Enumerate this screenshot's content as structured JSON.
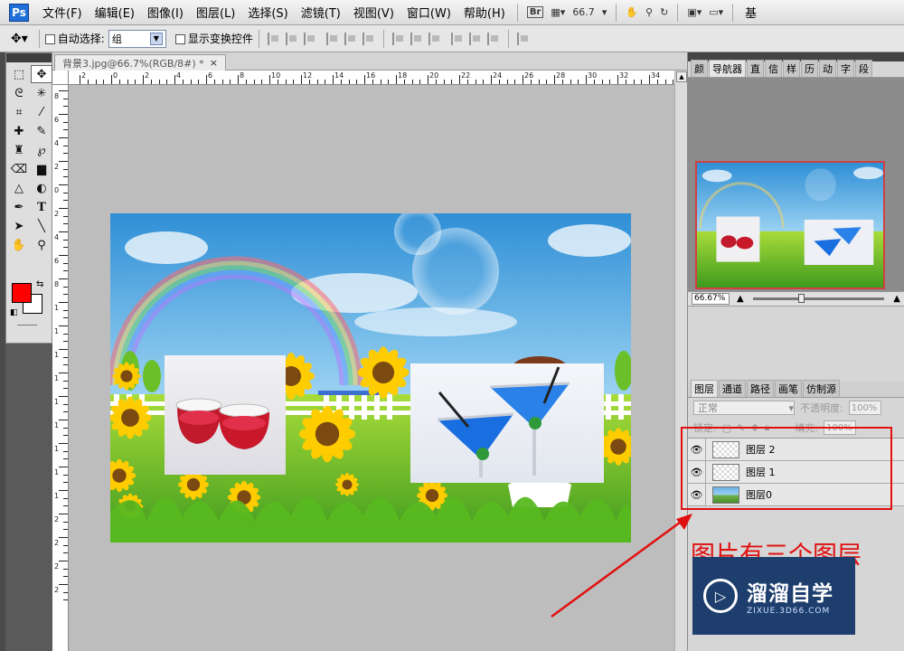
{
  "menubar": {
    "app_logo": "Ps",
    "items": [
      "文件(F)",
      "编辑(E)",
      "图像(I)",
      "图层(L)",
      "选择(S)",
      "滤镜(T)",
      "视图(V)",
      "窗口(W)",
      "帮助(H)"
    ],
    "bridge": "Br",
    "zoom_value": "66.7",
    "workspace": "基"
  },
  "options": {
    "auto_select_label": "自动选择:",
    "auto_select_value": "组",
    "show_transform_label": "显示变换控件"
  },
  "document": {
    "tab_title": "背景3.jpg@66.7%(RGB/8#) *",
    "close_glyph": "×",
    "ruler_h_labels": [
      "2",
      "0",
      "2",
      "4",
      "6",
      "8",
      "10",
      "12",
      "14",
      "16",
      "18",
      "20",
      "22",
      "24",
      "26",
      "28",
      "30",
      "32",
      "34"
    ],
    "ruler_v_labels": [
      "8",
      "6",
      "4",
      "2",
      "0",
      "2",
      "4",
      "6",
      "8",
      "1",
      "1",
      "1",
      "1",
      "1",
      "1",
      "1",
      "1",
      "1",
      "2",
      "2",
      "2",
      "2"
    ]
  },
  "navigator": {
    "tabs": [
      "颜",
      "导航器",
      "直",
      "信",
      "样",
      "历",
      "动",
      "字",
      "段"
    ],
    "zoom": "66.67%"
  },
  "layers": {
    "tabs": [
      "图层",
      "通道",
      "路径",
      "画笔",
      "仿制源"
    ],
    "blend_mode": "正常",
    "opacity_label": "不透明度:",
    "opacity_value": "100%",
    "lock_label": "锁定:",
    "fill_label": "填充:",
    "fill_value": "100%",
    "items": [
      {
        "name": "图层 2",
        "thumb": "transparent"
      },
      {
        "name": "图层 1",
        "thumb": "transparent"
      },
      {
        "name": "图层0",
        "thumb": "image"
      }
    ]
  },
  "annotation": {
    "text": "图片有三个图层"
  },
  "watermark": {
    "title": "溜溜自学",
    "subtitle": "ZIXUE.3D66.COM"
  },
  "colors": {
    "foreground": "#ff0000",
    "background": "#ffffff",
    "annotation_red": "#e01010",
    "app_logo_blue": "#1f6fd8"
  }
}
